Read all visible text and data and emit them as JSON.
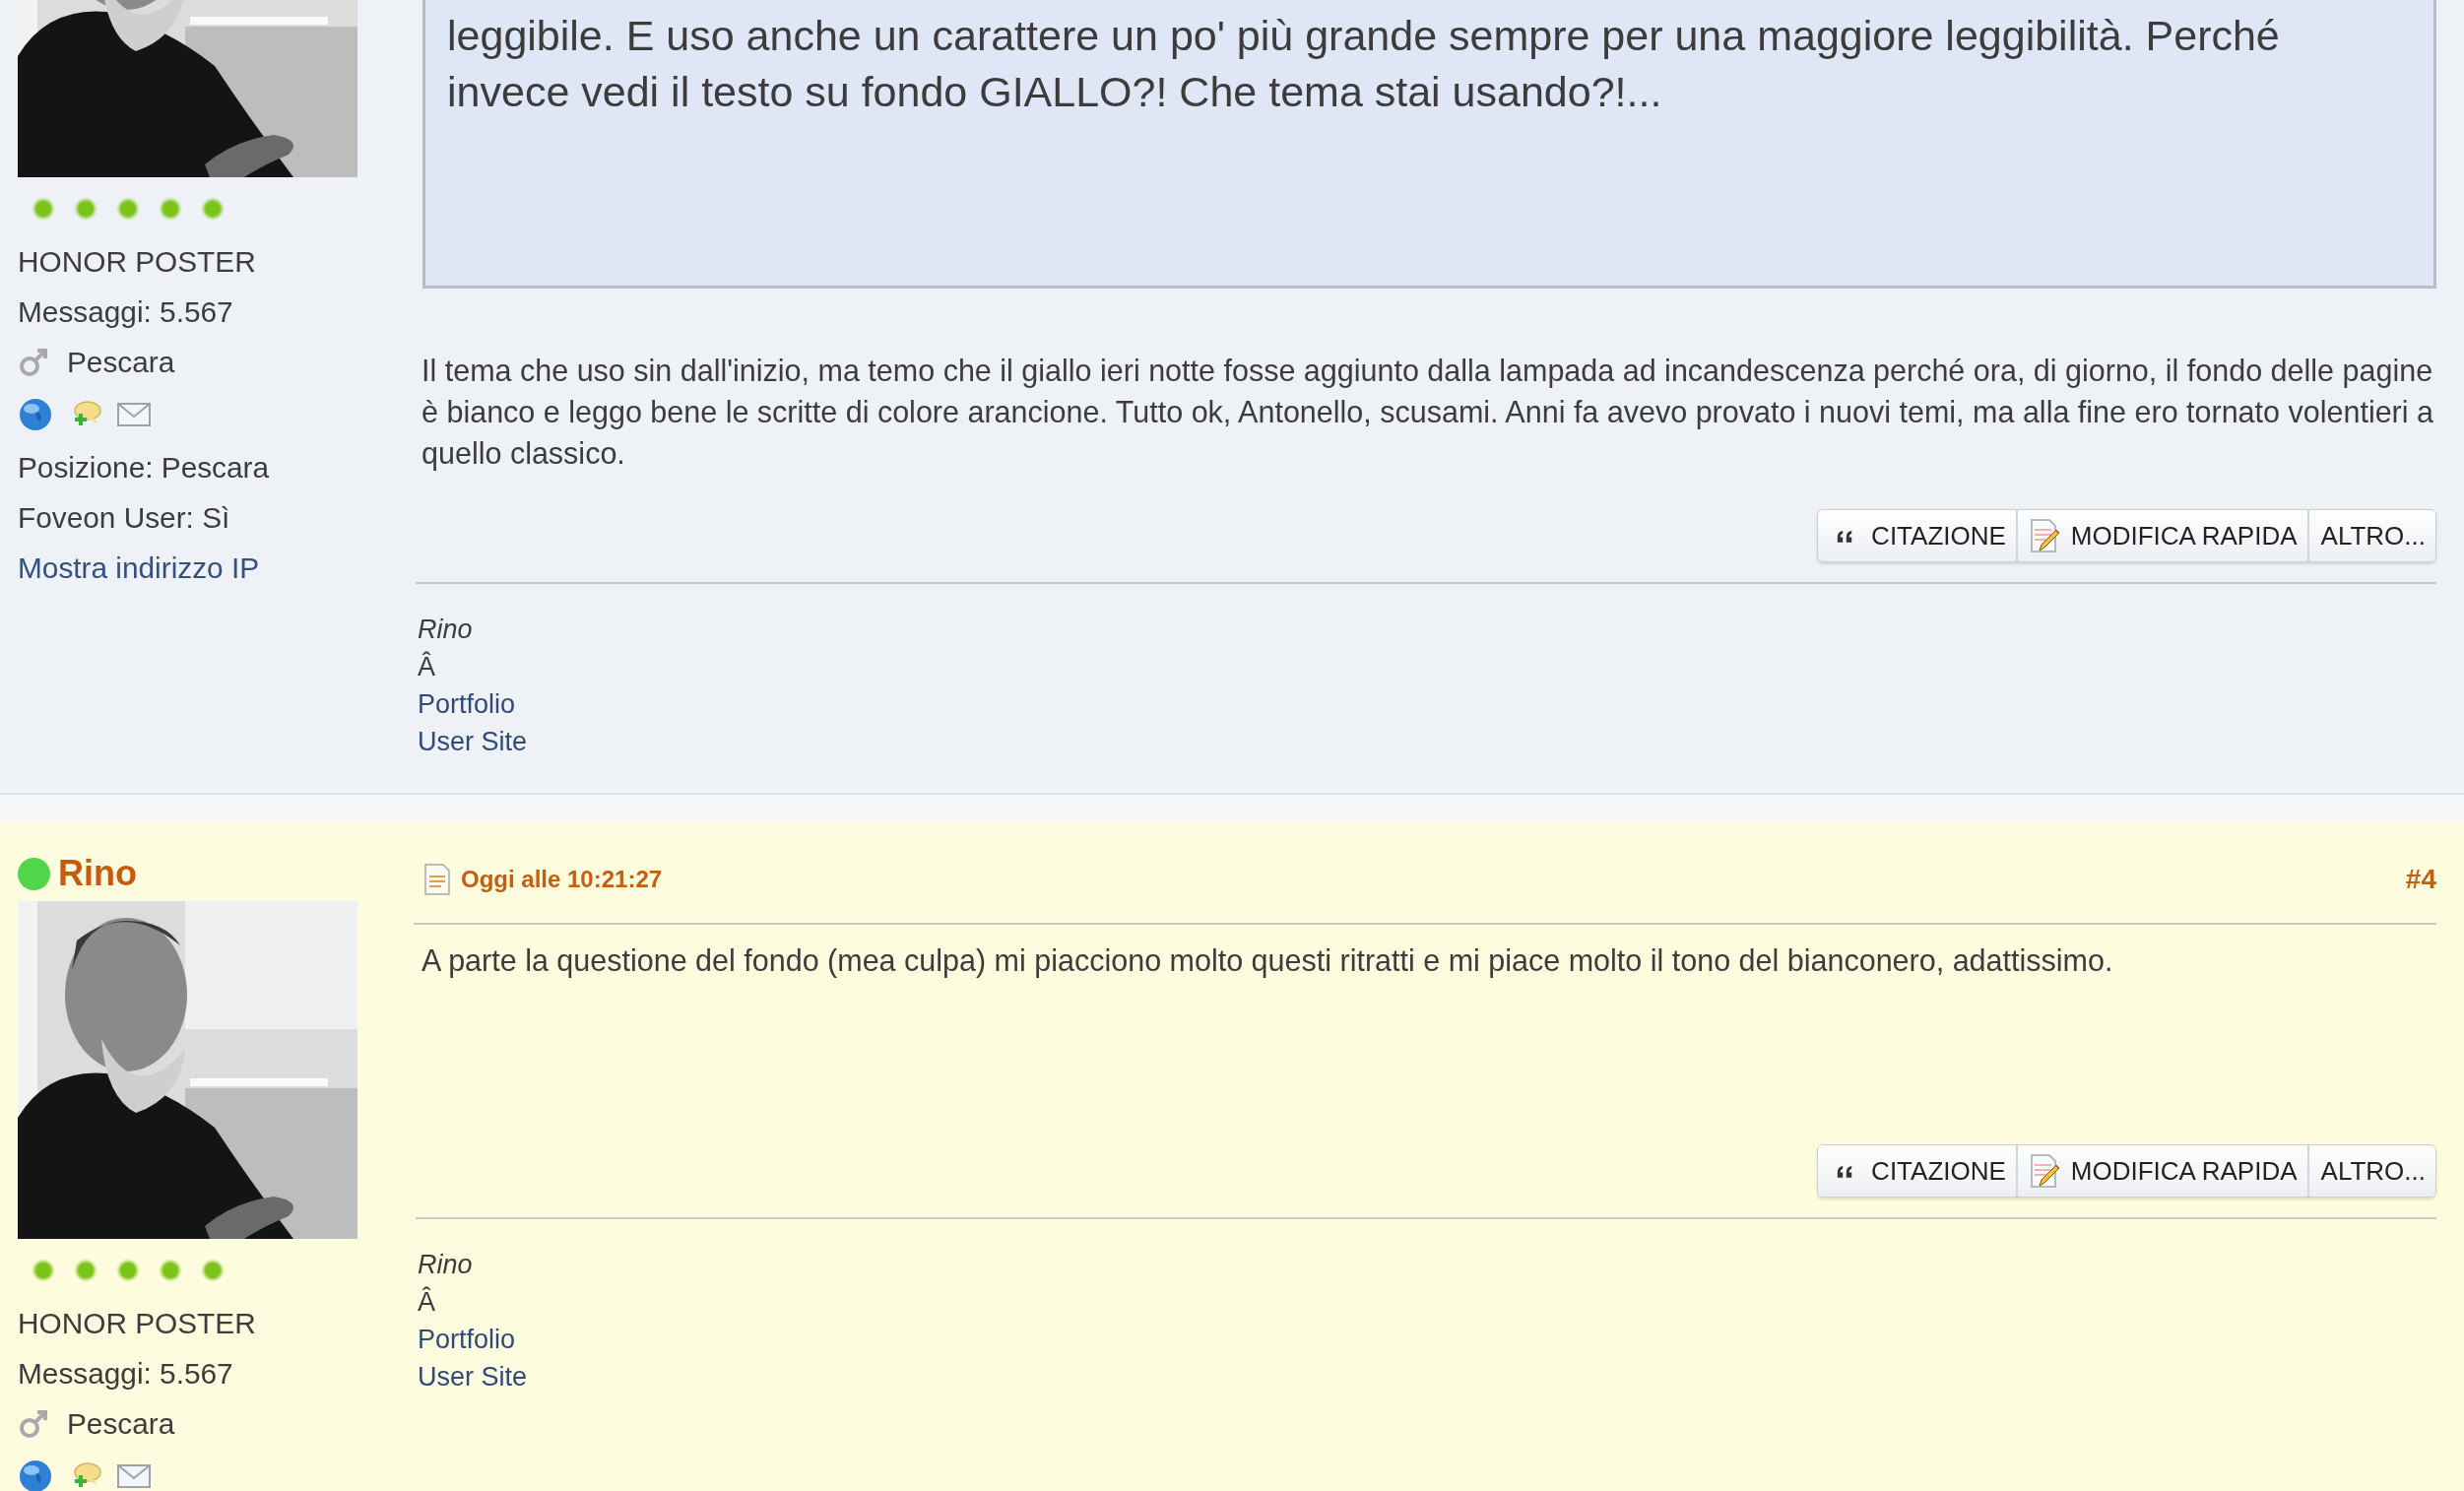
{
  "posts": [
    {
      "avatar": {
        "kind": "picture"
      },
      "stars": 5,
      "rank": "HONOR POSTER",
      "messages": "Messaggi: 5.567",
      "location": "Pescara",
      "details": [
        "Posizione: Pescara",
        "Foveon User: Sì"
      ],
      "ip_link": "Mostra indirizzo IP",
      "quote": "leggibile. E uso anche un carattere un po' più grande sempre per una maggiore leggibilità. Perché invece vedi il testo su fondo GIALLO?! Che tema stai usando?!...",
      "body": "Il tema che uso sin dall'inizio, ma temo che il giallo ieri notte fosse aggiunto dalla lampada ad incandescenza perché ora, di giorno, il fondo delle pagine è bianco e leggo bene le scritte di colore arancione. Tutto ok, Antonello, scusami. Anni fa avevo provato i nuovi temi, ma alla fine ero tornato volentieri a quello classico.",
      "buttons": [
        {
          "label": "CITAZIONE",
          "kind": "quote"
        },
        {
          "label": "MODIFICA RAPIDA",
          "kind": "edit"
        },
        {
          "label": "ALTRO...",
          "kind": "more"
        }
      ],
      "signature": {
        "name": "Rino",
        "text": "Â",
        "links": [
          "Portfolio",
          "User Site"
        ]
      }
    },
    {
      "author": {
        "name": "Rino",
        "online": true
      },
      "avatar": {
        "kind": "picture"
      },
      "stars": 5,
      "rank": "HONOR POSTER",
      "messages": "Messaggi: 5.567",
      "location": "Pescara",
      "date": "Oggi alle 10:21:27",
      "number": "#4",
      "body": "A parte la questione del fondo (mea culpa) mi piacciono molto questi ritratti e mi piace molto il tono del bianconero, adattissimo.",
      "buttons": [
        {
          "label": "CITAZIONE",
          "kind": "quote"
        },
        {
          "label": "MODIFICA RAPIDA",
          "kind": "edit"
        },
        {
          "label": "ALTRO...",
          "kind": "more"
        }
      ],
      "signature": {
        "name": "Rino",
        "text": "Â",
        "links": [
          "Portfolio",
          "User Site"
        ]
      }
    }
  ]
}
